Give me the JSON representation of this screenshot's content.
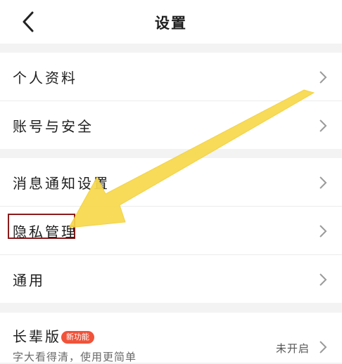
{
  "header": {
    "title": "设置"
  },
  "groups": {
    "account": {
      "items": [
        {
          "label": "个人资料"
        },
        {
          "label": "账号与安全"
        }
      ]
    },
    "general": {
      "items": [
        {
          "label": "消息通知设置"
        },
        {
          "label": "隐私管理"
        },
        {
          "label": "通用"
        }
      ]
    },
    "elder": {
      "label": "长辈版",
      "badge": "新功能",
      "sublabel": "字大看得清，使用更简单",
      "status": "未开启"
    }
  },
  "annotation": {
    "arrow_color": "#f7d94c",
    "highlight_color": "#8b1a1a"
  },
  "icons": [
    "back-icon",
    "chevron-right-icon"
  ]
}
